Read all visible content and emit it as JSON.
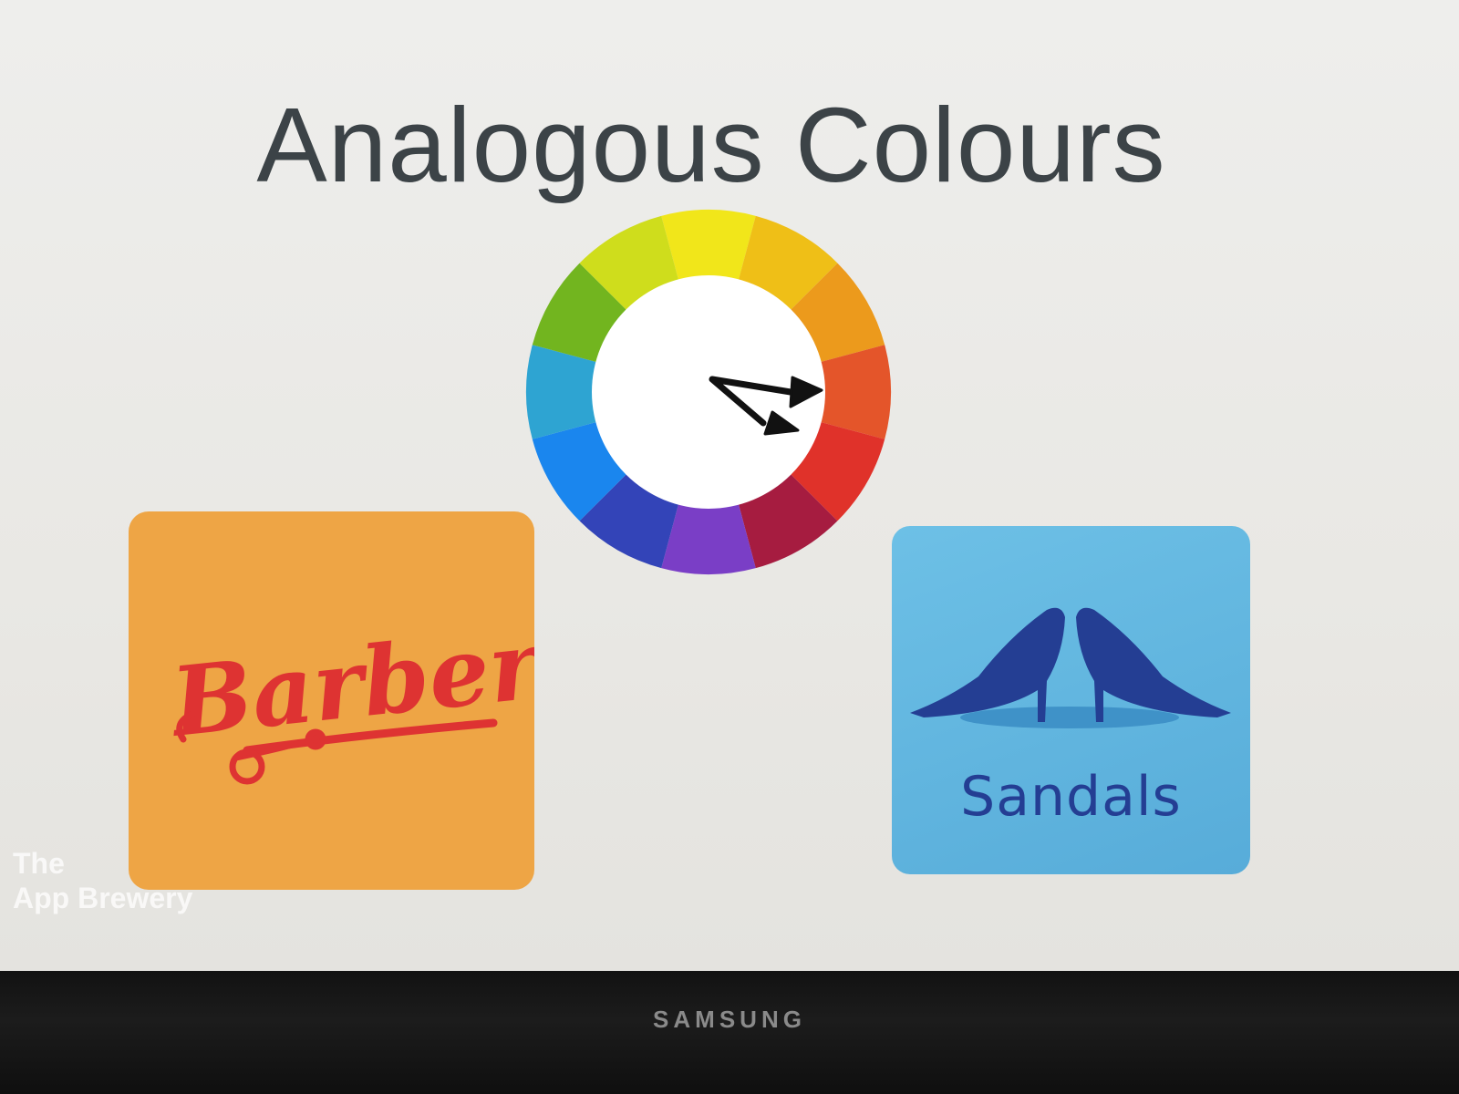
{
  "slide": {
    "title": "Analogous Colours"
  },
  "colour_wheel": {
    "segments": [
      {
        "name": "yellow",
        "color": "#f1e61a"
      },
      {
        "name": "yellow-orange",
        "color": "#efbf17"
      },
      {
        "name": "orange",
        "color": "#ec9a1c"
      },
      {
        "name": "red-orange",
        "color": "#e4552a"
      },
      {
        "name": "red",
        "color": "#e0322a"
      },
      {
        "name": "red-violet",
        "color": "#a61c40"
      },
      {
        "name": "violet",
        "color": "#7a3ec6"
      },
      {
        "name": "blue-violet",
        "color": "#3344b8"
      },
      {
        "name": "blue",
        "color": "#1a86ee"
      },
      {
        "name": "blue-green",
        "color": "#2ea4d2"
      },
      {
        "name": "green",
        "color": "#72b51f"
      },
      {
        "name": "yellow-green",
        "color": "#cfdd1c"
      }
    ],
    "arrows_point_to": [
      "red-orange",
      "red"
    ]
  },
  "barber_logo": {
    "background": "#eea545",
    "text": "Barber",
    "text_color": "#de3332",
    "icon": "scissors-icon"
  },
  "sandals_logo": {
    "background": "#5db3dd",
    "label": "Sandals",
    "label_color": "#243e93",
    "icon": "high-heels-icon"
  },
  "watermark": {
    "line1": "The",
    "line2": "App Brewery"
  },
  "monitor": {
    "brand": "SAMSUNG"
  }
}
